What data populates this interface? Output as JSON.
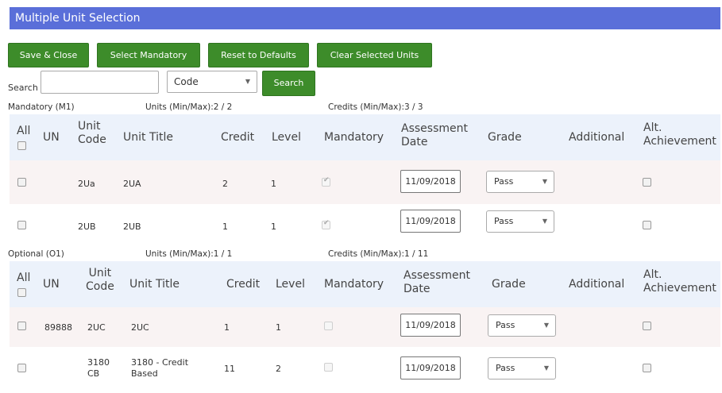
{
  "window": {
    "title": "Multiple Unit Selection"
  },
  "toolbar": {
    "save_close": "Save & Close",
    "select_mandatory": "Select Mandatory",
    "reset_defaults": "Reset to Defaults",
    "clear_selected": "Clear Selected Units"
  },
  "search": {
    "label": "Search",
    "value": "",
    "field": "Code",
    "button": "Search"
  },
  "columns": {
    "all": "All",
    "un": "UN",
    "unit_code_1": "Unit",
    "unit_code_2": "Code",
    "unit_title": "Unit Title",
    "credit": "Credit",
    "level": "Level",
    "mandatory": "Mandatory",
    "assessment_date_1": "Assessment",
    "assessment_date_2": "Date",
    "grade": "Grade",
    "additional": "Additional",
    "alt_achievement_1": "Alt.",
    "alt_achievement_2": "Achievement"
  },
  "sections": [
    {
      "name": "Mandatory (M1)",
      "units": "Units (Min/Max):2 / 2",
      "credits": "Credits (Min/Max):3 / 3",
      "rows": [
        {
          "un": "",
          "code": "2Ua",
          "code2": "",
          "title": "2UA",
          "title2": "",
          "credit": "2",
          "level": "1",
          "mandatory": true,
          "date": "11/09/2018",
          "grade": "Pass"
        },
        {
          "un": "",
          "code": "2UB",
          "code2": "",
          "title": "2UB",
          "title2": "",
          "credit": "1",
          "level": "1",
          "mandatory": true,
          "date": "11/09/2018",
          "grade": "Pass"
        }
      ]
    },
    {
      "name": "Optional (O1)",
      "units": "Units (Min/Max):1 / 1",
      "credits": "Credits (Min/Max):1 / 11",
      "rows": [
        {
          "un": "89888",
          "code": "2UC",
          "code2": "",
          "title": "2UC",
          "title2": "",
          "credit": "1",
          "level": "1",
          "mandatory": false,
          "date": "11/09/2018",
          "grade": "Pass"
        },
        {
          "un": "",
          "code": "3180",
          "code2": "CB",
          "title": "3180 - Credit",
          "title2": "Based",
          "credit": "11",
          "level": "2",
          "mandatory": false,
          "date": "11/09/2018",
          "grade": "Pass"
        }
      ]
    }
  ],
  "colors": {
    "titlebar": "#5a6fd9",
    "button": "#3d8c2a",
    "header_row": "#ecf2fb",
    "alt_row": "#f9f3f3"
  }
}
